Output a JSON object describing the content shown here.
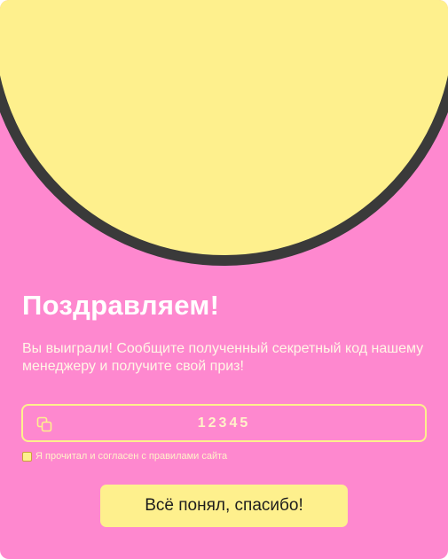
{
  "popup": {
    "title": "Поздравляем!",
    "message": "Вы выиграли! Сообщите полученный секретный код нашему менеджеру и получите свой приз!",
    "code": "12345",
    "agreement_label": "Я прочитал и согласен с правилами сайта",
    "agreement_checked": true,
    "button_label": "Всё понял, спасибо!"
  },
  "colors": {
    "background": "#fe88cf",
    "accent": "#fef08d",
    "circle_border": "#3a3a3a",
    "button_text": "#1d1d1d"
  },
  "icons": {
    "copy": "copy-icon"
  }
}
